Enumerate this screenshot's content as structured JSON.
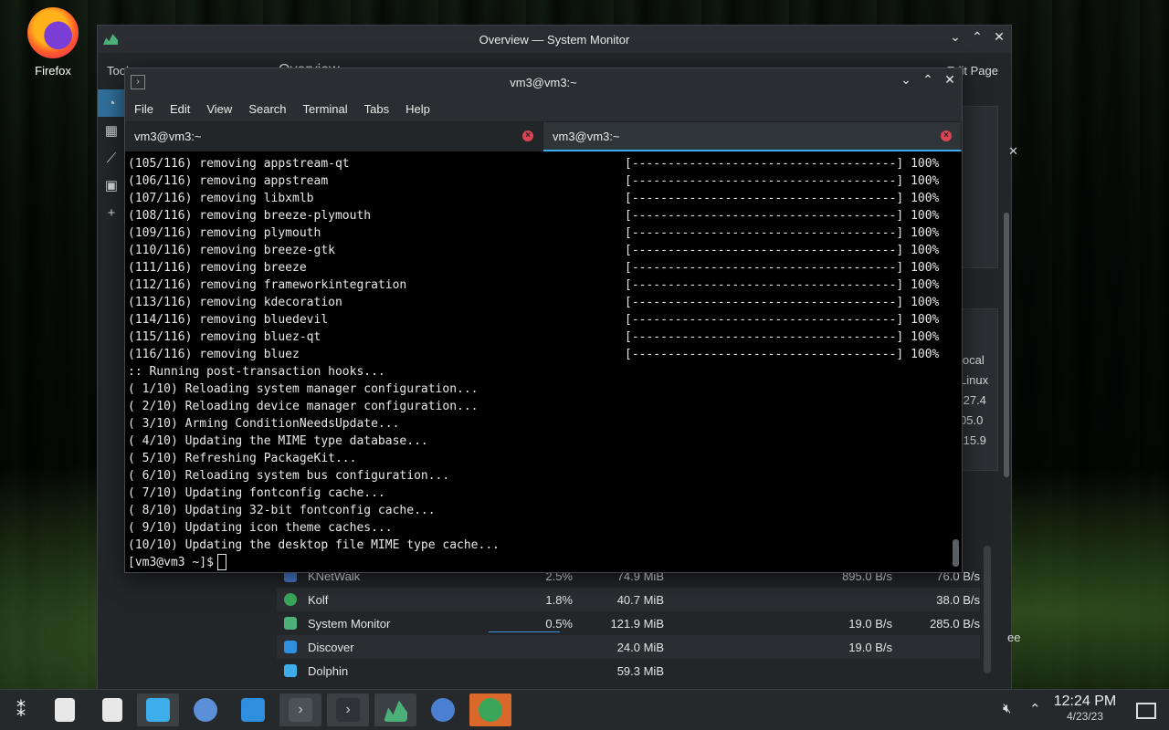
{
  "desktop": {
    "firefox_label": "Firefox"
  },
  "sysmon": {
    "title": "Overview — System Monitor",
    "toolbar": {
      "tools": "Tools",
      "page": "Overview",
      "edit": "Edit Page"
    },
    "info_partial": [
      "local",
      "Linux",
      ".27.4",
      "05.0",
      ".15.9"
    ],
    "info_tail": "ee",
    "processes": [
      {
        "name": "KNetWalk",
        "cpu": "2.5%",
        "memory": "74.9 MiB",
        "read": "895.0 B/s",
        "write": "76.0 B/s",
        "color": "#4a7fd1"
      },
      {
        "name": "Kolf",
        "cpu": "1.8%",
        "memory": "40.7 MiB",
        "read": "",
        "write": "38.0 B/s",
        "color": "#3aa65a"
      },
      {
        "name": "System Monitor",
        "cpu": "0.5%",
        "memory": "121.9 MiB",
        "read": "19.0 B/s",
        "write": "285.0 B/s",
        "color": "#4caf7a"
      },
      {
        "name": "Discover",
        "cpu": "",
        "memory": "24.0 MiB",
        "read": "19.0 B/s",
        "write": "",
        "color": "#2e8fde"
      },
      {
        "name": "Dolphin",
        "cpu": "",
        "memory": "59.3 MiB",
        "read": "",
        "write": "",
        "color": "#3daee9"
      }
    ]
  },
  "terminal": {
    "title": "vm3@vm3:~",
    "menu": [
      "File",
      "Edit",
      "View",
      "Search",
      "Terminal",
      "Tabs",
      "Help"
    ],
    "tabs": [
      "vm3@vm3:~",
      "vm3@vm3:~"
    ],
    "progress_lines": [
      {
        "left": "(105/116) removing appstream-qt",
        "right": "[-------------------------------------] 100%"
      },
      {
        "left": "(106/116) removing appstream",
        "right": "[-------------------------------------] 100%"
      },
      {
        "left": "(107/116) removing libxmlb",
        "right": "[-------------------------------------] 100%"
      },
      {
        "left": "(108/116) removing breeze-plymouth",
        "right": "[-------------------------------------] 100%"
      },
      {
        "left": "(109/116) removing plymouth",
        "right": "[-------------------------------------] 100%"
      },
      {
        "left": "(110/116) removing breeze-gtk",
        "right": "[-------------------------------------] 100%"
      },
      {
        "left": "(111/116) removing breeze",
        "right": "[-------------------------------------] 100%"
      },
      {
        "left": "(112/116) removing frameworkintegration",
        "right": "[-------------------------------------] 100%"
      },
      {
        "left": "(113/116) removing kdecoration",
        "right": "[-------------------------------------] 100%"
      },
      {
        "left": "(114/116) removing bluedevil",
        "right": "[-------------------------------------] 100%"
      },
      {
        "left": "(115/116) removing bluez-qt",
        "right": "[-------------------------------------] 100%"
      },
      {
        "left": "(116/116) removing bluez",
        "right": "[-------------------------------------] 100%"
      }
    ],
    "hook_lines": [
      ":: Running post-transaction hooks...",
      "( 1/10) Reloading system manager configuration...",
      "( 2/10) Reloading device manager configuration...",
      "( 3/10) Arming ConditionNeedsUpdate...",
      "( 4/10) Updating the MIME type database...",
      "( 5/10) Refreshing PackageKit...",
      "( 6/10) Reloading system bus configuration...",
      "( 7/10) Updating fontconfig cache...",
      "( 8/10) Updating 32-bit fontconfig cache...",
      "( 9/10) Updating icon theme caches...",
      "(10/10) Updating the desktop file MIME type cache..."
    ],
    "prompt": "[vm3@vm3 ~]$"
  },
  "taskbar": {
    "clock_time": "12:24 PM",
    "clock_date": "4/23/23",
    "accent": "#3daee9",
    "items": [
      "app-launcher-icon",
      "document-audio-icon",
      "document-audio-icon",
      "dolphin-icon",
      "system-settings-icon",
      "discover-icon",
      "terminal-icon",
      "terminal-icon",
      "system-monitor-icon",
      "knetwalk-icon",
      "kolf-icon"
    ]
  }
}
